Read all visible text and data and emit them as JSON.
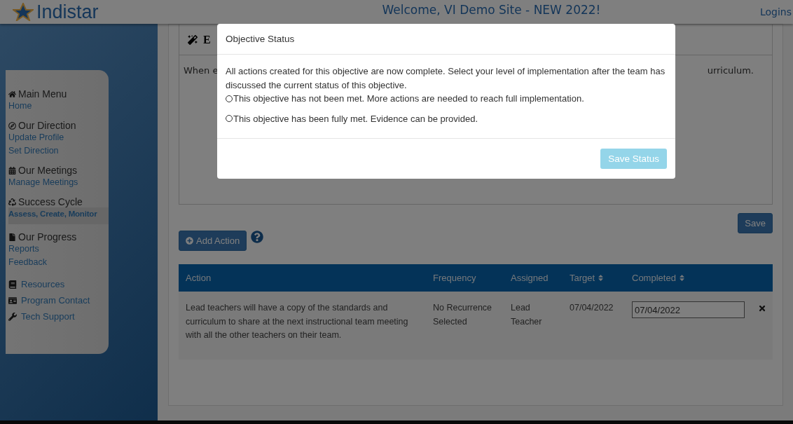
{
  "header": {
    "logo": "Indistar",
    "title": "Welcome, VI Demo Site - NEW 2022!",
    "link": "Logins"
  },
  "sidebar": {
    "groups": [
      {
        "title": "Main Menu",
        "links": [
          {
            "label": "Home",
            "selected": false
          }
        ]
      },
      {
        "title": "Our Direction",
        "links": [
          {
            "label": "Update Profile",
            "selected": false
          },
          {
            "label": "Set Direction",
            "selected": false
          }
        ]
      },
      {
        "title": "Our Meetings",
        "links": [
          {
            "label": "Manage Meetings",
            "selected": false
          }
        ]
      },
      {
        "title": "Success Cycle",
        "links": [
          {
            "label": "Assess, Create, Monitor",
            "selected": true
          }
        ]
      },
      {
        "title": "Our Progress",
        "links": [
          {
            "label": "Reports",
            "selected": false
          },
          {
            "label": "Feedback",
            "selected": false
          }
        ]
      }
    ],
    "extra_links": [
      {
        "label": "Resources"
      },
      {
        "label": "Program Contact"
      },
      {
        "label": "Tech Support"
      }
    ]
  },
  "editor": {
    "heading": "E",
    "text_start": "When e",
    "text_end": "urriculum."
  },
  "save_button": "Save",
  "add_action_button": "Add Action",
  "table": {
    "columns": [
      {
        "label": "Action",
        "sortable": false
      },
      {
        "label": "Frequency",
        "sortable": false
      },
      {
        "label": "Assigned",
        "sortable": false
      },
      {
        "label": "Target",
        "sortable": true
      },
      {
        "label": "Completed",
        "sortable": true
      }
    ],
    "rows": [
      {
        "action": "Lead teachers will have a copy of the standards and curriculum to share at the next instructional team meeting with all the other teachers on their team.",
        "frequency": "No Recurrence Selected",
        "assigned": "Lead Teacher",
        "target": "07/04/2022",
        "completed": "07/04/2022"
      }
    ]
  },
  "modal": {
    "title": "Objective Status",
    "message": "All actions created for this objective are now complete. Select your level of implementation after the team has discussed the current status of this objective.",
    "options": [
      {
        "label": "This objective has not been met. More actions are needed to reach full implementation.",
        "selected": false
      },
      {
        "label": "This objective has been fully met. Evidence can be provided.",
        "selected": false
      }
    ],
    "button": {
      "label": "Save Status",
      "disabled": true
    }
  }
}
